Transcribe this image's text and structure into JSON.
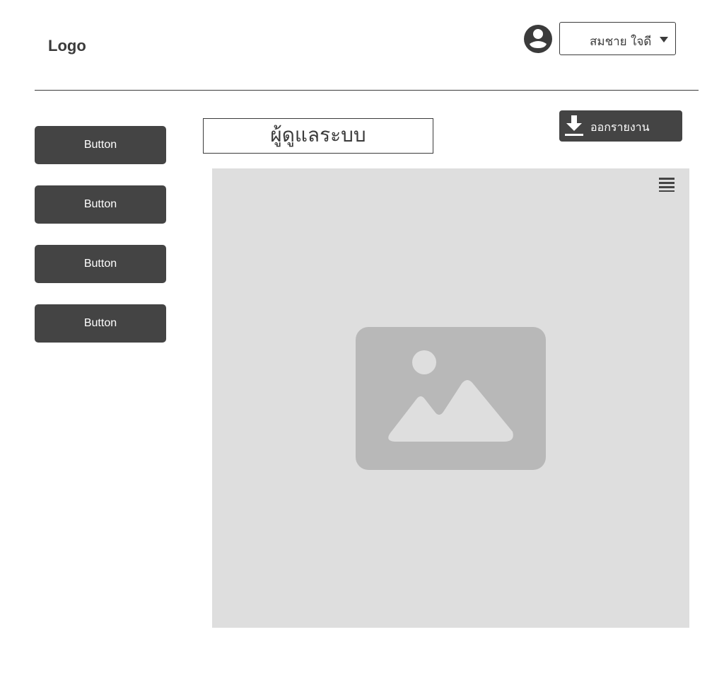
{
  "header": {
    "logo": "Logo",
    "avatar_icon": "user-circle-icon",
    "user_select": {
      "selected": "สมชาย ใจดี",
      "chevron_icon": "chevron-down-icon"
    }
  },
  "sidebar": {
    "buttons": [
      {
        "label": "Button"
      },
      {
        "label": "Button"
      },
      {
        "label": "Button"
      },
      {
        "label": "Button"
      }
    ]
  },
  "main": {
    "title": "ผู้ดูแลระบบ",
    "export_button": {
      "label": "ออกรายงาน",
      "icon": "download-icon"
    },
    "panel": {
      "menu_icon": "hamburger-menu-icon",
      "placeholder_icon": "image-placeholder-icon"
    }
  },
  "colors": {
    "primary_dark": "#444444",
    "text": "#3b3b3b",
    "panel_bg": "#dedede",
    "placeholder": "#b8b8b8"
  }
}
